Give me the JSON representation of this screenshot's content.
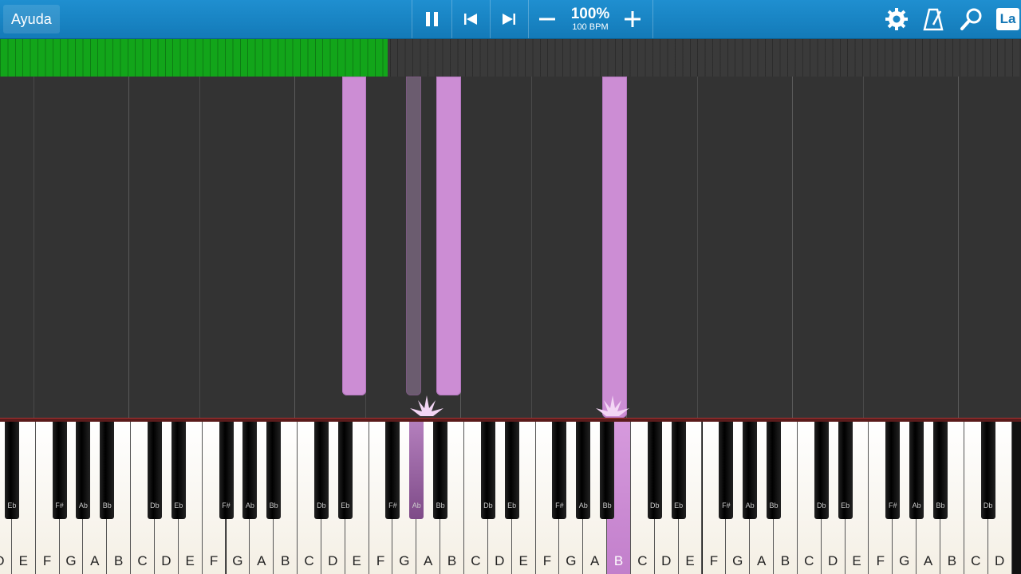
{
  "toolbar": {
    "help_label": "Ayuda",
    "speed_percent": "100%",
    "speed_bpm": "100 BPM",
    "language_label": "La",
    "icons": [
      "pause-icon",
      "previous-icon",
      "next-icon",
      "minus-icon",
      "plus-icon",
      "gear-icon",
      "metronome-icon",
      "search-icon"
    ]
  },
  "progress": {
    "fraction": 0.38
  },
  "colors": {
    "toolbar": "#1a86c6",
    "progress": "#12a51a",
    "note": "#cc8dd4",
    "active_key": "#c98fd1"
  },
  "keyboard": {
    "white_keys": [
      "D",
      "E",
      "F",
      "G",
      "A",
      "B",
      "C",
      "D",
      "E",
      "F",
      "G",
      "A",
      "B",
      "C",
      "D",
      "E",
      "F",
      "G",
      "A",
      "B",
      "C",
      "D",
      "E",
      "F",
      "G",
      "A",
      "B",
      "C",
      "D",
      "E",
      "F",
      "G",
      "A",
      "B",
      "C",
      "D",
      "E",
      "F",
      "G",
      "A",
      "B",
      "C",
      "D"
    ],
    "black_keys": [
      "Eb",
      "F#",
      "Ab",
      "Bb",
      "Db",
      "Eb",
      "F#",
      "Ab",
      "Bb",
      "Db",
      "Eb",
      "F#",
      "Ab",
      "Bb",
      "Db",
      "Eb",
      "F#",
      "Ab",
      "Bb",
      "Db",
      "Eb",
      "F#",
      "Ab",
      "Bb",
      "Db",
      "Eb",
      "F#",
      "Ab",
      "Bb",
      "Db",
      "Eb"
    ],
    "active_white_index": 26,
    "active_black_indices": [
      12
    ]
  }
}
